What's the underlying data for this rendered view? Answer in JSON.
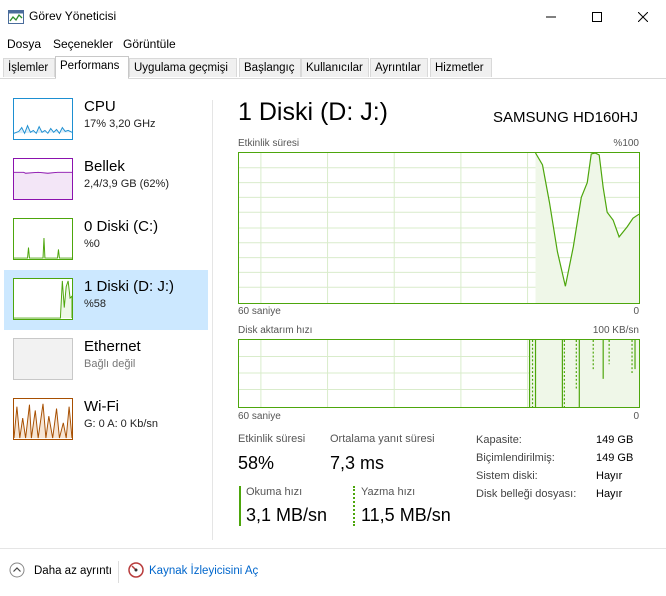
{
  "window": {
    "title": "Görev Yöneticisi"
  },
  "menu": [
    "Dosya",
    "Seçenekler",
    "Görüntüle"
  ],
  "tabs": [
    "İşlemler",
    "Performans",
    "Uygulama geçmişi",
    "Başlangıç",
    "Kullanıcılar",
    "Ayrıntılar",
    "Hizmetler"
  ],
  "active_tab": "Performans",
  "sidebar": [
    {
      "name": "CPU",
      "sub": "17% 3,20 GHz",
      "color": "#1d8fd1"
    },
    {
      "name": "Bellek",
      "sub": "2,4/3,9 GB (62%)",
      "color": "#8b12ae"
    },
    {
      "name": "0 Diski (C:)",
      "sub": "%0",
      "color": "#4da60c"
    },
    {
      "name": "1 Diski (D: J:)",
      "sub": "%58",
      "color": "#4da60c"
    },
    {
      "name": "Ethernet",
      "sub": "Bağlı değil",
      "color": "#a7a7a7"
    },
    {
      "name": "Wi-Fi",
      "sub": "G: 0 A: 0 Kb/sn",
      "color": "#a74f01"
    }
  ],
  "selected_index": 3,
  "main": {
    "title": "1 Diski (D: J:)",
    "model": "SAMSUNG HD160HJ",
    "graph1": {
      "label": "Etkinlik süresi",
      "max": "%100",
      "left": "60 saniye",
      "right": "0"
    },
    "graph2": {
      "label": "Disk aktarım hızı",
      "max": "100 KB/sn",
      "left": "60 saniye",
      "right": "0"
    }
  },
  "stats": {
    "active_label": "Etkinlik süresi",
    "active_value": "58%",
    "resp_label": "Ortalama yanıt süresi",
    "resp_value": "7,3 ms",
    "read_label": "Okuma hızı",
    "read_value": "3,1 MB/sn",
    "write_label": "Yazma hızı",
    "write_value": "11,5 MB/sn"
  },
  "props": [
    {
      "label": "Kapasite:",
      "value": "149 GB"
    },
    {
      "label": "Biçimlendirilmiş:",
      "value": "149 GB"
    },
    {
      "label": "Sistem diski:",
      "value": "Hayır"
    },
    {
      "label": "Disk belleği dosyası:",
      "value": "Hayır"
    }
  ],
  "footer": {
    "less": "Daha az ayrıntı",
    "monitor": "Kaynak İzleyicisini Aç"
  },
  "colors": {
    "disk": "#4da60c",
    "disk_fill": "#eff7e8",
    "selected_bg": "#cce8ff"
  }
}
